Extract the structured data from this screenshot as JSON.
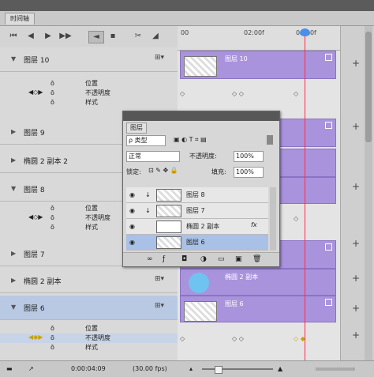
{
  "panel": {
    "tab_label": "时间轴"
  },
  "toolbar": {
    "buttons": [
      {
        "name": "first-frame",
        "glyph": "⏮"
      },
      {
        "name": "prev-frame",
        "glyph": "◀"
      },
      {
        "name": "play",
        "glyph": "▶"
      },
      {
        "name": "next-frame",
        "glyph": "▶▶"
      },
      {
        "name": "audio",
        "glyph": "◄"
      },
      {
        "name": "settings",
        "glyph": "▪"
      },
      {
        "name": "split",
        "glyph": "✂"
      },
      {
        "name": "transition",
        "glyph": "◢"
      }
    ]
  },
  "ruler": {
    "ticks": [
      "00",
      "02:00f",
      "04:00f"
    ]
  },
  "layers": [
    {
      "name": "图层 10",
      "expanded": true,
      "selected": false,
      "props": [
        "位置",
        "不透明度",
        "样式"
      ],
      "clip_label": "图层 10"
    },
    {
      "name": "图层 9",
      "expanded": false,
      "selected": false,
      "props": [],
      "clip_label": ""
    },
    {
      "name": "椭圆 2 副本 2",
      "expanded": false,
      "selected": false,
      "props": [],
      "clip_label": ""
    },
    {
      "name": "图层 8",
      "expanded": true,
      "selected": false,
      "props": [
        "位置",
        "不透明度",
        "样式"
      ],
      "clip_label": ""
    },
    {
      "name": "图层 7",
      "expanded": false,
      "selected": false,
      "props": [],
      "clip_label": ""
    },
    {
      "name": "椭圆 2 副本",
      "expanded": false,
      "selected": false,
      "props": [],
      "clip_label": "椭圆 2 副本"
    },
    {
      "name": "图层 6",
      "expanded": true,
      "selected": true,
      "props": [
        "位置",
        "不透明度",
        "样式"
      ],
      "clip_label": "图层 6"
    }
  ],
  "bottom": {
    "timecode": "0:00:04:09",
    "fps": "(30.00 fps)"
  },
  "layers_panel": {
    "tab_label": "图层",
    "filter_label": "ρ 类型",
    "blend_mode": "正常",
    "opacity_label": "不透明度:",
    "opacity_value": "100%",
    "lock_label": "锁定:",
    "fill_label": "填充:",
    "fill_value": "100%",
    "items": [
      {
        "name": "图层 8",
        "selected": false,
        "fx": ""
      },
      {
        "name": "图层 7",
        "selected": false,
        "fx": ""
      },
      {
        "name": "椭圆 2 副本",
        "selected": false,
        "fx": "fx"
      },
      {
        "name": "图层 6",
        "selected": true,
        "fx": ""
      }
    ]
  },
  "colors": {
    "clip": "#a993dc",
    "playhead": "#ff2a4a",
    "selection": "#b9c9e3"
  }
}
